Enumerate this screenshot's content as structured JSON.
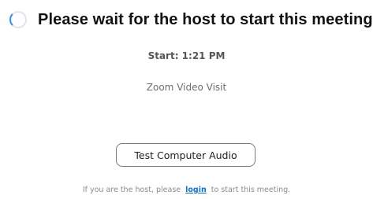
{
  "header": {
    "title": "Please wait for the host to start this meeting."
  },
  "meeting": {
    "start": "Start: 1:21 PM",
    "topic": "Zoom Video Visit"
  },
  "actions": {
    "test_audio_label": "Test Computer Audio"
  },
  "host_note": {
    "prefix": "If you are the host, please",
    "link_label": "login",
    "suffix": "to start this meeting."
  },
  "colors": {
    "accent": "#2d8cff",
    "link": "#0e71eb"
  },
  "icons": {
    "loading": "spinner-icon"
  }
}
